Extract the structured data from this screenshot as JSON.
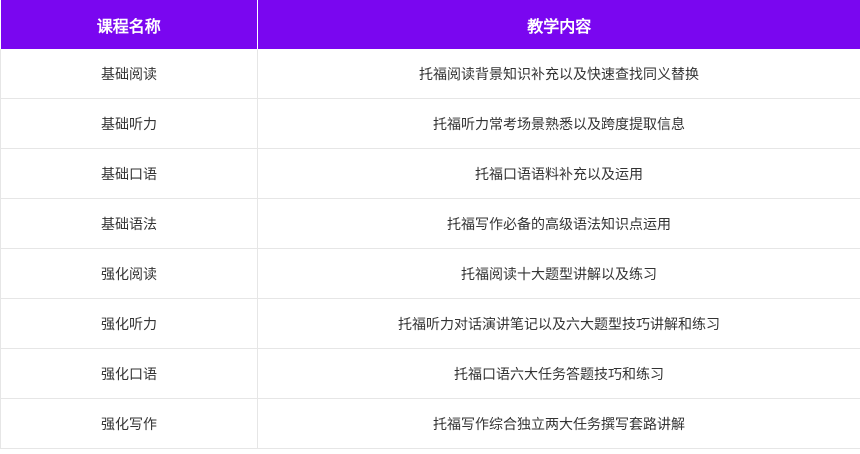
{
  "table": {
    "header_bg": "#7a06f0",
    "columns": [
      "课程名称",
      "教学内容"
    ],
    "rows": [
      {
        "course": "基础阅读",
        "content": "托福阅读背景知识补充以及快速查找同义替换"
      },
      {
        "course": "基础听力",
        "content": "托福听力常考场景熟悉以及跨度提取信息"
      },
      {
        "course": "基础口语",
        "content": "托福口语语料补充以及运用"
      },
      {
        "course": "基础语法",
        "content": "托福写作必备的高级语法知识点运用"
      },
      {
        "course": "强化阅读",
        "content": "托福阅读十大题型讲解以及练习"
      },
      {
        "course": "强化听力",
        "content": "托福听力对话演讲笔记以及六大题型技巧讲解和练习"
      },
      {
        "course": "强化口语",
        "content": "托福口语六大任务答题技巧和练习"
      },
      {
        "course": "强化写作",
        "content": "托福写作综合独立两大任务撰写套路讲解"
      }
    ]
  }
}
